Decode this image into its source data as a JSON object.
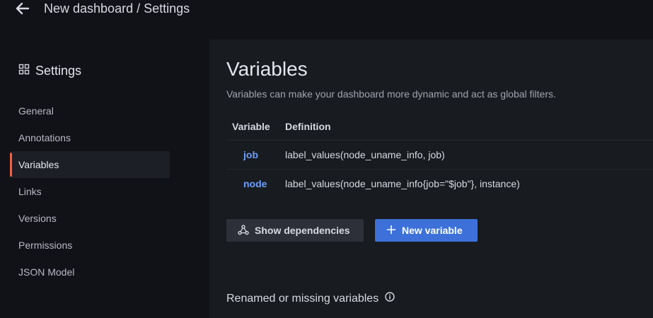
{
  "header": {
    "breadcrumb": "New dashboard / Settings",
    "back_icon": "arrow-left-icon"
  },
  "sidebar": {
    "title": "Settings",
    "title_icon": "apps-grid-icon",
    "items": [
      {
        "label": "General",
        "active": false
      },
      {
        "label": "Annotations",
        "active": false
      },
      {
        "label": "Variables",
        "active": true
      },
      {
        "label": "Links",
        "active": false
      },
      {
        "label": "Versions",
        "active": false
      },
      {
        "label": "Permissions",
        "active": false
      },
      {
        "label": "JSON Model",
        "active": false
      }
    ],
    "active_accent": "#f55f3e"
  },
  "main": {
    "title": "Variables",
    "description": "Variables can make your dashboard more dynamic and act as global filters.",
    "table": {
      "headers": [
        "Variable",
        "Definition"
      ],
      "rows": [
        {
          "variable": "job",
          "definition": "label_values(node_uname_info, job)"
        },
        {
          "variable": "node",
          "definition": "label_values(node_uname_info{job=\"$job\"}, instance)"
        }
      ]
    },
    "buttons": {
      "show_dependencies": "Show dependencies",
      "show_dependencies_icon": "graph-nodes-icon",
      "new_variable": "New variable",
      "new_variable_icon": "plus-icon"
    },
    "renamed_section": {
      "title": "Renamed or missing variables",
      "icon": "info-circle-icon"
    }
  },
  "colors": {
    "background": "#111217",
    "panel": "#181b1f",
    "primary_button": "#3d71d9",
    "link": "#6e9fff"
  }
}
